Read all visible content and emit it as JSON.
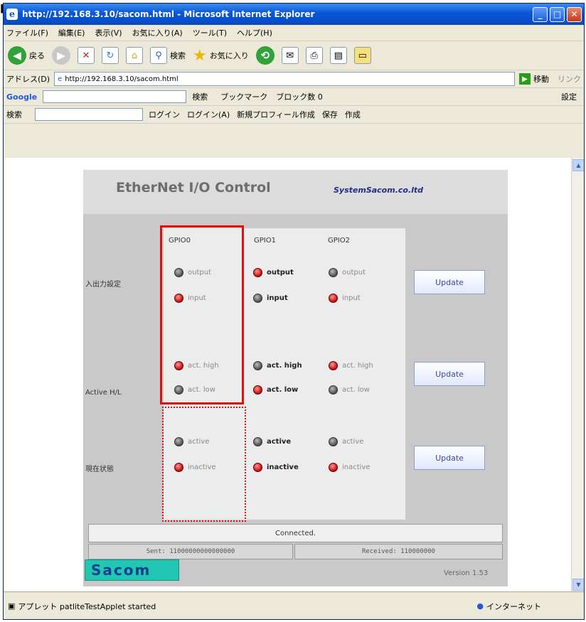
{
  "window": {
    "title": "http://192.168.3.10/sacom.html - Microsoft Internet Explorer"
  },
  "menu": [
    "ファイル(F)",
    "編集(E)",
    "表示(V)",
    "お気に入り(A)",
    "ツール(T)",
    "ヘルプ(H)"
  ],
  "toolbar": {
    "back": "戻る",
    "search": "検索",
    "favorites": "お気に入り"
  },
  "address": {
    "label": "アドレス(D)",
    "url": "http://192.168.3.10/sacom.html",
    "go": "移動",
    "links": "リンク"
  },
  "google": {
    "label": "Google",
    "search": "検索",
    "bookmarks": "ブックマーク",
    "popup_blocked": "ブロック数 0",
    "settings": "設定"
  },
  "bar2": {
    "search": "検索",
    "login": "ログイン",
    "login_auto": "ログイン(A)",
    "new_profile": "新規プロフィール作成",
    "save": "保存",
    "create": "作成"
  },
  "page": {
    "title": "EtherNet I/O Control",
    "company": "SystemSacom.co.ltd",
    "columns": [
      "GPIO0",
      "GPIO1",
      "GPIO2"
    ],
    "rows": [
      {
        "label": "入出力設定",
        "options": [
          "output",
          "input"
        ],
        "selected": [
          "input",
          "output",
          "input"
        ],
        "button": "Update"
      },
      {
        "label": "Active H/L",
        "options": [
          "act. high",
          "act. low"
        ],
        "selected": [
          "act. high",
          "act. low",
          "act. high"
        ],
        "button": "Update"
      },
      {
        "label": "現在状態",
        "options": [
          "active",
          "inactive"
        ],
        "selected": [
          "inactive",
          "inactive",
          "inactive"
        ],
        "button": "Update"
      }
    ],
    "status": "Connected.",
    "sent": "Sent: 11000000000000000",
    "received": "Received: 110000000",
    "logo": "Sacom",
    "version": "Version 1.53"
  },
  "statusbar": {
    "left": "アプレット patliteTestApplet started",
    "right": "インターネット"
  }
}
